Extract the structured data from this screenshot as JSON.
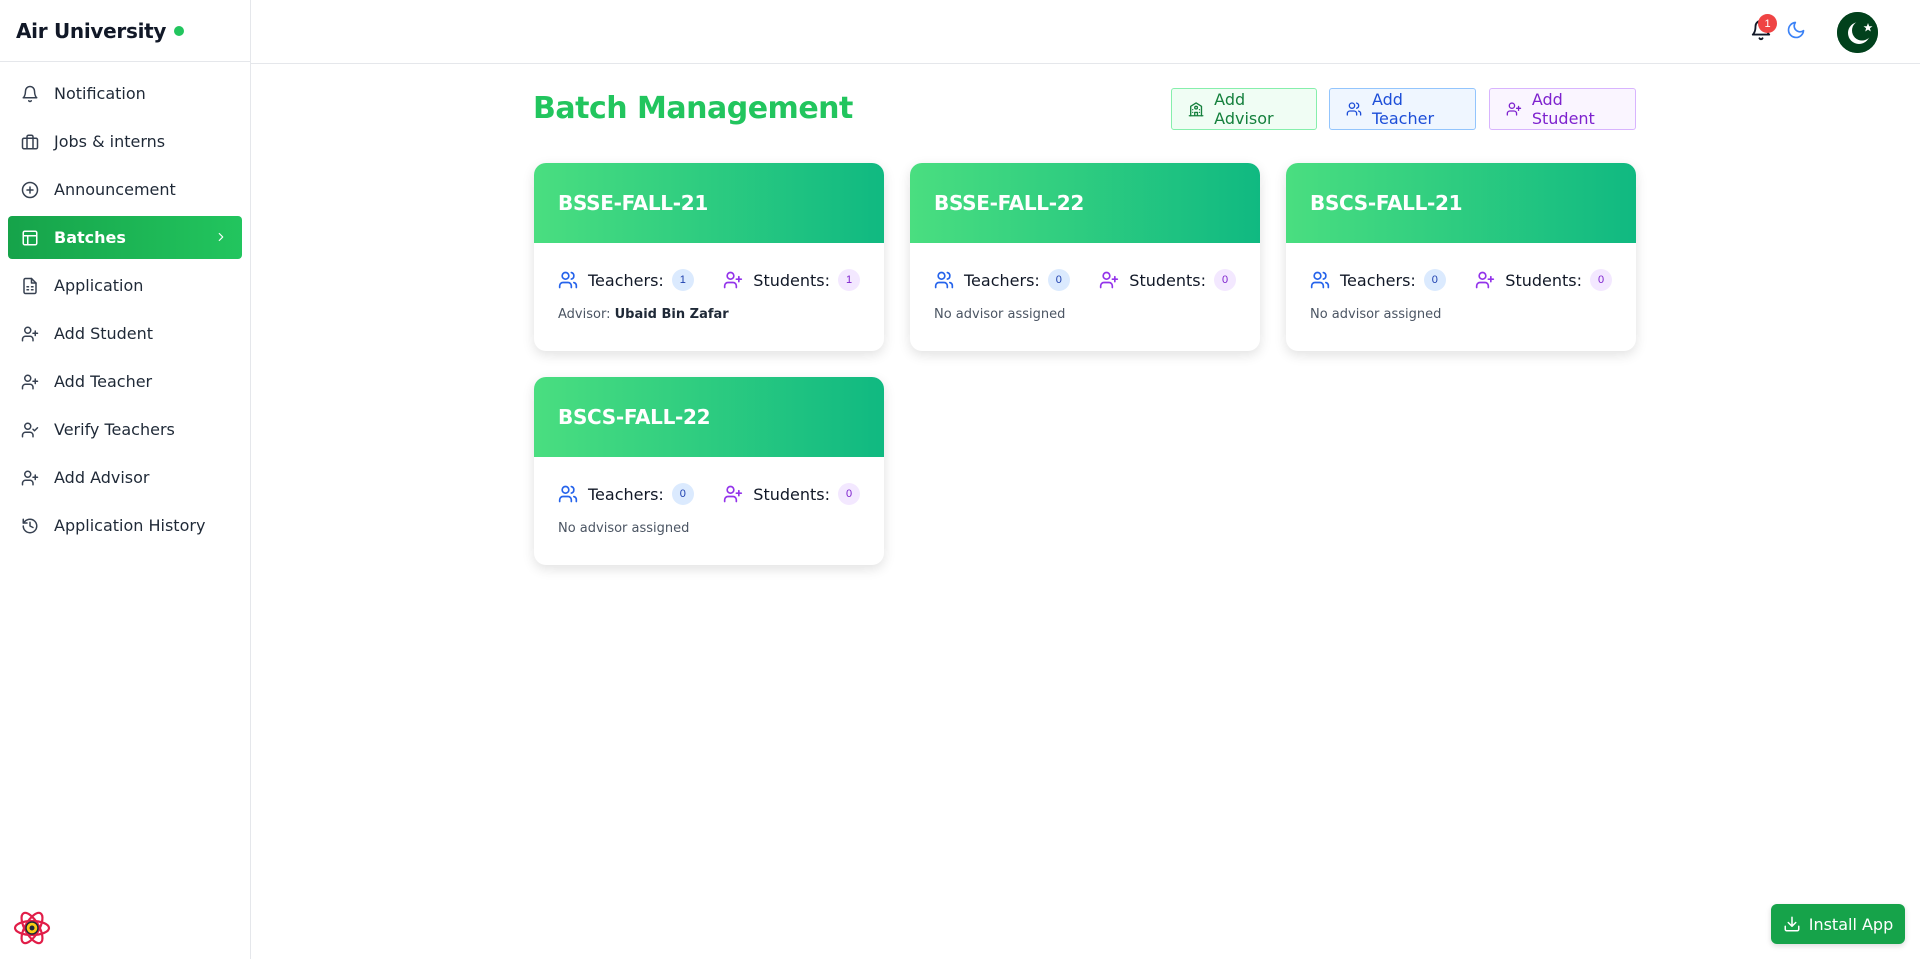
{
  "app": {
    "title": "Air University",
    "status_color": "#22c55e"
  },
  "sidebar": {
    "items": [
      {
        "label": "Notification",
        "icon": "bell-icon"
      },
      {
        "label": "Jobs & interns",
        "icon": "briefcase-icon"
      },
      {
        "label": "Announcement",
        "icon": "plus-circle-icon"
      },
      {
        "label": "Batches",
        "icon": "layout-icon",
        "active": true
      },
      {
        "label": "Application",
        "icon": "file-text-icon"
      },
      {
        "label": "Add Student",
        "icon": "user-plus-icon"
      },
      {
        "label": "Add Teacher",
        "icon": "user-plus-icon"
      },
      {
        "label": "Verify Teachers",
        "icon": "user-check-icon"
      },
      {
        "label": "Add Advisor",
        "icon": "user-plus-icon"
      },
      {
        "label": "Application History",
        "icon": "history-icon"
      }
    ]
  },
  "header": {
    "notification_count": "1"
  },
  "main": {
    "title": "Batch Management",
    "actions": {
      "add_advisor": "Add Advisor",
      "add_teacher": "Add Teacher",
      "add_student": "Add Student"
    },
    "stat_labels": {
      "teachers": "Teachers:",
      "students": "Students:"
    },
    "batches": [
      {
        "name": "BSSE-FALL-21",
        "teachers": "1",
        "students": "1",
        "advisor_prefix": "Advisor:",
        "advisor_name": "Ubaid Bin Zafar",
        "advisor_text": ""
      },
      {
        "name": "BSSE-FALL-22",
        "teachers": "0",
        "students": "0",
        "advisor_prefix": "",
        "advisor_name": "",
        "advisor_text": "No advisor assigned"
      },
      {
        "name": "BSCS-FALL-21",
        "teachers": "0",
        "students": "0",
        "advisor_prefix": "",
        "advisor_name": "",
        "advisor_text": "No advisor assigned"
      },
      {
        "name": "BSCS-FALL-22",
        "teachers": "0",
        "students": "0",
        "advisor_prefix": "",
        "advisor_name": "",
        "advisor_text": "No advisor assigned"
      }
    ]
  },
  "install": {
    "label": "Install App"
  },
  "colors": {
    "accent": "#22c55e",
    "teacher": "#2563eb",
    "student": "#9333ea",
    "badge": "#ef4444"
  }
}
